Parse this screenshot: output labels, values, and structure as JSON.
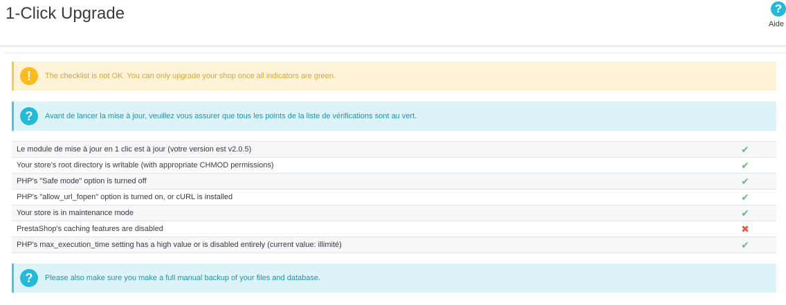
{
  "page": {
    "title": "1-Click Upgrade",
    "help_label": "Aide",
    "help_icon_glyph": "?"
  },
  "alerts": {
    "warning": {
      "icon_glyph": "!",
      "text": "The checklist is not OK. You can only upgrade your shop once all indicators are green."
    },
    "info_top": {
      "icon_glyph": "?",
      "text": "Avant de lancer la mise à jour, veuillez vous assurer que tous les points de la liste de vérifications sont au vert."
    },
    "info_bottom": {
      "icon_glyph": "?",
      "text": "Please also make sure you make a full manual backup of your files and database."
    }
  },
  "checklist": [
    {
      "label": "Le module de mise à jour en 1 clic est à jour (votre version est v2.0.5)",
      "status": "ok",
      "glyph": "✔"
    },
    {
      "label": "Your store's root directory is writable (with appropriate CHMOD permissions)",
      "status": "ok",
      "glyph": "✔"
    },
    {
      "label": "PHP's \"Safe mode\" option is turned off",
      "status": "ok",
      "glyph": "✔"
    },
    {
      "label": "PHP's \"allow_url_fopen\" option is turned on, or cURL is installed",
      "status": "ok",
      "glyph": "✔"
    },
    {
      "label": "Your store is in maintenance mode",
      "status": "ok",
      "glyph": "✔"
    },
    {
      "label": "PrestaShop's caching features are disabled",
      "status": "fail",
      "glyph": "✖"
    },
    {
      "label": "PHP's max_execution_time setting has a high value or is disabled entirely (current value: illimité)",
      "status": "ok",
      "glyph": "✔"
    }
  ],
  "colors": {
    "ok": "#70b580",
    "fail": "#e25a4a",
    "info": "#25b9d7",
    "warning": "#fbbb22"
  }
}
